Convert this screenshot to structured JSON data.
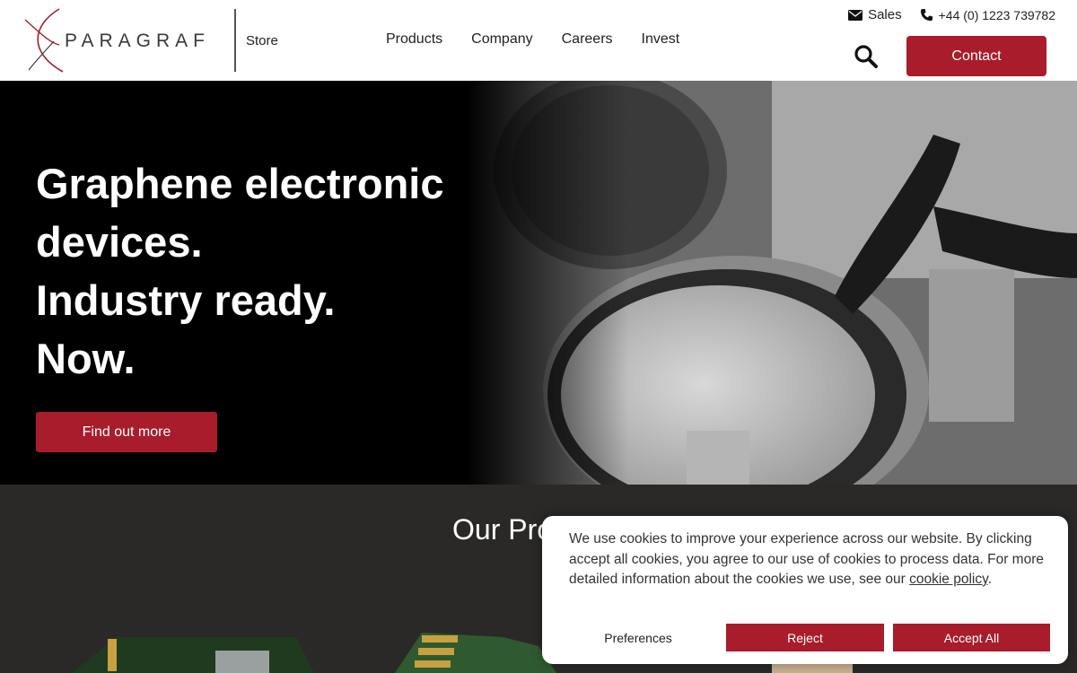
{
  "brand": {
    "name": "PARAGRAF",
    "accent": "#a81c2c"
  },
  "header": {
    "store_label": "Store",
    "nav": [
      "Products",
      "Company",
      "Careers",
      "Invest"
    ],
    "sales_label": "Sales",
    "phone": "+44 (0) 1223 739782",
    "contact_label": "Contact"
  },
  "hero": {
    "lines": [
      "Graphene electronic",
      "devices.",
      "Industry ready.",
      "Now."
    ],
    "cta_label": "Find out more"
  },
  "products": {
    "title": "Our Products"
  },
  "cookie": {
    "text": "We use cookies to improve your experience across our website. By clicking accept all cookies, you agree to our use of cookies to process data. For more detailed information about the cookies we use, see our ",
    "link_text": "cookie policy",
    "suffix": ".",
    "preferences_label": "Preferences",
    "reject_label": "Reject",
    "accept_label": "Accept All"
  }
}
